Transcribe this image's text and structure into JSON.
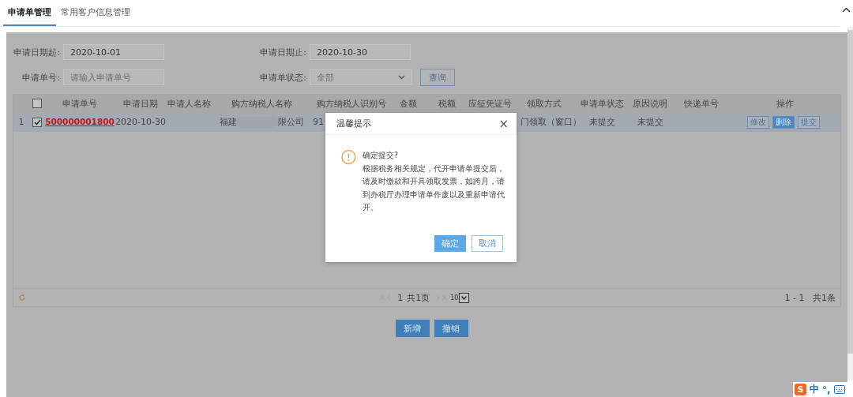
{
  "tabs": [
    {
      "label": "申请单管理",
      "selected": true
    },
    {
      "label": "常用客户信息管理",
      "selected": false
    }
  ],
  "filters": {
    "date_from": {
      "label": "申请日期起:",
      "value": "2020-10-01"
    },
    "date_to": {
      "label": "申请日期止:",
      "value": "2020-10-30"
    },
    "order_no": {
      "label": "申请单号:",
      "placeholder": "请输入申请单号"
    },
    "status": {
      "label": "申请单状态:",
      "value": "全部"
    },
    "query_button": "查询"
  },
  "table": {
    "header_checked": false,
    "columns": [
      "申请单号",
      "申请日期",
      "申请人名称",
      "购方纳税人名称",
      "购方纳税人识别号",
      "金额",
      "税额",
      "应征凭证号",
      "领取方式",
      "申请单状态",
      "原因说明",
      "快递单号",
      "操作"
    ],
    "rows": [
      {
        "index": "1",
        "checked": true,
        "selected": true,
        "order_no": "500000001800",
        "date": "2020-10-30",
        "buyer_name_start": "福建",
        "buyer_name_end": "限公司",
        "buyer_id": "91",
        "pickup": "门领取（窗口）",
        "status": "未提交",
        "reason": "未提交",
        "actions": [
          {
            "label": "修改",
            "primary": false
          },
          {
            "label": "删除",
            "primary": true
          },
          {
            "label": "提交",
            "primary": false
          }
        ]
      }
    ]
  },
  "pager": {
    "page": "1",
    "pages": "共1页",
    "page_size": "10",
    "summary": "1 - 1   共1条"
  },
  "buttons": [
    "新增",
    "撤销"
  ],
  "dialog": {
    "title": "温馨提示",
    "close": "×",
    "heading": "确定提交?",
    "message": "根据税务相关规定，代开申请单提交后，请及时缴款和开具领取发票，如跨月，请到办税厅办理申请单作废以及重新申请代开。",
    "ok": "确定",
    "cancel": "取消"
  },
  "ime": {
    "logo": "S",
    "mode": "中",
    "punct": "°,"
  }
}
